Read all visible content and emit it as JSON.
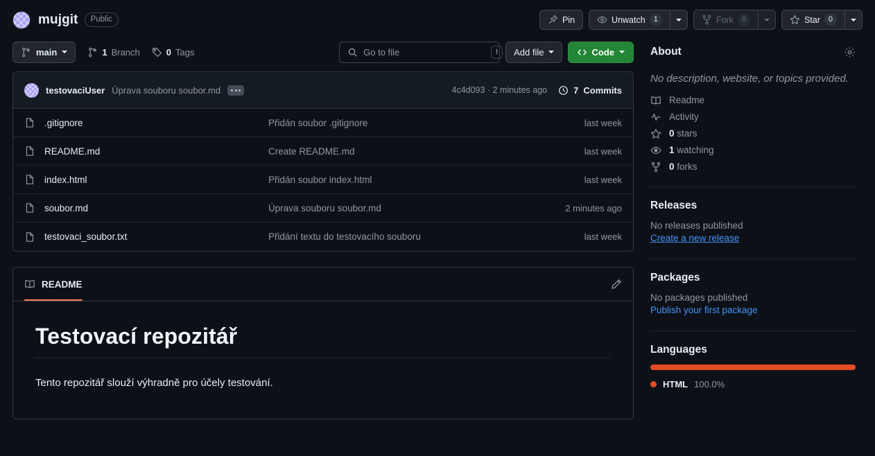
{
  "header": {
    "repo_name": "mujgit",
    "visibility": "Public",
    "avatar_icon": "repo-owner-avatar",
    "actions": {
      "pin_label": "Pin",
      "watch_label": "Unwatch",
      "watch_count": "1",
      "fork_label": "Fork",
      "fork_count": "0",
      "star_label": "Star",
      "star_count": "0"
    }
  },
  "toolbar": {
    "branch_label": "main",
    "branch_count": "1",
    "branch_word": "Branch",
    "tag_count": "0",
    "tag_word": "Tags",
    "search_placeholder": "Go to file",
    "search_value": "",
    "search_kbd": "t",
    "add_file_label": "Add file",
    "code_label": "Code"
  },
  "commit_bar": {
    "author": "testovaciUser",
    "message": "Úprava souboru soubor.md",
    "sha": "4c4d093",
    "sha_separator": "·",
    "relative_time": "2 minutes ago",
    "commits_count": "7",
    "commits_label": "Commits"
  },
  "files": [
    {
      "icon": "file-icon",
      "name": ".gitignore",
      "message": "Přidán soubor .gitignore",
      "time": "last week"
    },
    {
      "icon": "file-icon",
      "name": "README.md",
      "message": "Create README.md",
      "time": "last week"
    },
    {
      "icon": "file-icon",
      "name": "index.html",
      "message": "Přidán soubor index.html",
      "time": "last week"
    },
    {
      "icon": "file-icon",
      "name": "soubor.md",
      "message": "Úprava souboru soubor.md",
      "time": "2 minutes ago"
    },
    {
      "icon": "file-icon",
      "name": "testovaci_soubor.txt",
      "message": "Přidání textu do testovacího souboru",
      "time": "last week"
    }
  ],
  "readme": {
    "tab_label": "README",
    "heading": "Testovací repozitář",
    "paragraph": "Tento repozitář slouží výhradně pro účely testování."
  },
  "sidebar": {
    "about_title": "About",
    "description": "No description, website, or topics provided.",
    "items": [
      {
        "icon": "book-icon",
        "label": "Readme",
        "count": ""
      },
      {
        "icon": "activity-icon",
        "label": "Activity",
        "count": ""
      },
      {
        "icon": "star-icon",
        "label": "stars",
        "count": "0"
      },
      {
        "icon": "eye-icon",
        "label": "watching",
        "count": "1"
      },
      {
        "icon": "fork-icon",
        "label": "forks",
        "count": "0"
      }
    ],
    "releases": {
      "title": "Releases",
      "empty_text": "No releases published",
      "link_label": "Create a new release"
    },
    "packages": {
      "title": "Packages",
      "empty_text": "No packages published",
      "link_label": "Publish your first package"
    },
    "languages": {
      "title": "Languages",
      "entries": [
        {
          "name": "HTML",
          "percent": "100.0%",
          "color": "#e34c26",
          "width": "100%"
        }
      ]
    }
  },
  "colors": {
    "page_bg": "#0d1117",
    "border": "#30363d",
    "accent_green": "#238636",
    "link_blue": "#4493f8",
    "tab_underline": "#f78166",
    "html_lang": "#e34c26"
  }
}
